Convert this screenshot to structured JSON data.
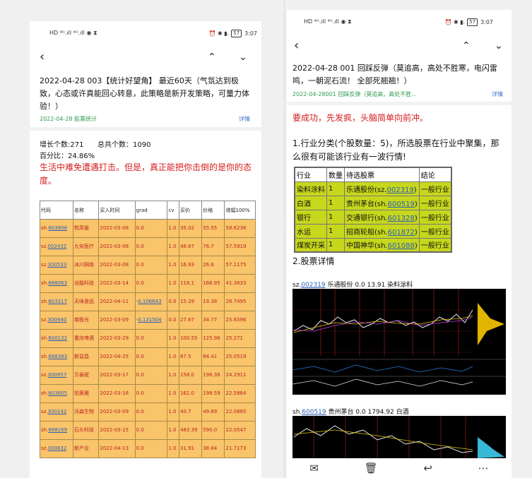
{
  "left": {
    "status": {
      "left_icons": "HD ⁴ᴳ.ıll ⁴ᴳ.ıll ◉ ⧗",
      "right_icons": "⏰ ✱ ▮ᵢ",
      "battery": "57",
      "time": "3:07"
    },
    "nav": {
      "back": "‹",
      "up": "⌃",
      "down": "⌄"
    },
    "title": "2022-04-28 003【统计好望角】 最近60天（气氛达到极致，心态或许真能回心转意，此策略是新开发策略，可量力体验！）",
    "meta": "2022-04-28 股票统计",
    "detail": "详情",
    "stats": {
      "growth": "增长个数:271",
      "total": "总共个数：1090",
      "percent": "百分比：24.86%"
    },
    "quote": "生活中难免遭遇打击。但是，真正能把你击倒的是你的态度。",
    "table": {
      "headers": [
        "代码",
        "名称",
        "买入时间",
        "grad",
        "cv",
        "买价",
        "价格",
        "增幅100%"
      ],
      "rows": [
        {
          "prefix": "sh.",
          "code": "603908",
          "name": "牧高笛",
          "date": "2022-03-08",
          "grad": "0.0",
          "cv": "1.0",
          "buy": "35.02",
          "price": "55.55",
          "inc": "58.6236"
        },
        {
          "prefix": "sz.",
          "code": "002432",
          "name": "九安医疗",
          "date": "2022-03-08",
          "grad": "0.0",
          "cv": "1.0",
          "buy": "48.67",
          "price": "76.7",
          "inc": "57.5919"
        },
        {
          "prefix": "sz.",
          "code": "300533",
          "name": "冰川网络",
          "date": "2022-03-08",
          "grad": "0.0",
          "cv": "1.0",
          "buy": "16.93",
          "price": "26.6",
          "inc": "57.1175"
        },
        {
          "prefix": "sh.",
          "code": "688063",
          "name": "派能科技",
          "date": "2022-03-14",
          "grad": "0.0",
          "cv": "1.0",
          "buy": "118.1",
          "price": "166.95",
          "inc": "41.3633"
        },
        {
          "prefix": "sh.",
          "code": "603317",
          "name": "天味食品",
          "date": "2022-04-11",
          "grad": "-0.106643",
          "cv": "0.0",
          "buy": "15.29",
          "price": "19.38",
          "inc": "26.7495"
        },
        {
          "prefix": "sz.",
          "code": "300940",
          "name": "南极光",
          "date": "2022-03-09",
          "grad": "-0.131504",
          "cv": "0.0",
          "buy": "27.67",
          "price": "34.77",
          "inc": "25.6596"
        },
        {
          "prefix": "sh.",
          "code": "600132",
          "name": "重庆啤酒",
          "date": "2022-03-29",
          "grad": "0.0",
          "cv": "1.0",
          "buy": "100.55",
          "price": "125.96",
          "inc": "25.271"
        },
        {
          "prefix": "sh.",
          "code": "688383",
          "name": "新益昌",
          "date": "2022-04-25",
          "grad": "0.0",
          "cv": "1.0",
          "buy": "67.5",
          "price": "84.41",
          "inc": "25.0519"
        },
        {
          "prefix": "sz.",
          "code": "300957",
          "name": "贝泰妮",
          "date": "2022-03-17",
          "grad": "0.0",
          "cv": "1.0",
          "buy": "158.0",
          "price": "196.38",
          "inc": "24.2911"
        },
        {
          "prefix": "sh.",
          "code": "603605",
          "name": "珀莱雅",
          "date": "2022-03-16",
          "grad": "0.0",
          "cv": "1.0",
          "buy": "162.0",
          "price": "198.59",
          "inc": "22.5864"
        },
        {
          "prefix": "sz.",
          "code": "300142",
          "name": "沃森生物",
          "date": "2022-03-09",
          "grad": "0.0",
          "cv": "1.0",
          "buy": "40.7",
          "price": "49.69",
          "inc": "22.0885"
        },
        {
          "prefix": "sh.",
          "code": "688169",
          "name": "石头科技",
          "date": "2022-03-15",
          "grad": "0.0",
          "cv": "1.0",
          "buy": "483.39",
          "price": "590.0",
          "inc": "22.0547"
        },
        {
          "prefix": "sz.",
          "code": "300832",
          "name": "新产业",
          "date": "2022-04-13",
          "grad": "0.0",
          "cv": "1.0",
          "buy": "31.91",
          "price": "38.84",
          "inc": "21.7173"
        }
      ]
    }
  },
  "right": {
    "status": {
      "left_icons": "HD ⁴ᴳ.ıll ⁴ᴳ.ıll ◉ ⧗",
      "right_icons": "⏰ ✱ ▮ᵢ",
      "battery": "57",
      "time": "3:07"
    },
    "nav": {
      "back": "‹",
      "up": "⌃",
      "down": "⌄"
    },
    "title": "2022-04-28 001 回踩反弹（莫追高，高处不胜寒，电闪雷鸣，一朝泥石流！ 全部死翘翘！）",
    "meta": "2022-04-28001 回踩反弹（莫追高，高处不胜...",
    "detail": "详情",
    "slogan": "要成功，先发疯，头脑简单向前冲。",
    "section1": "1.行业分类(个股数量：5)，所选股票在行业中聚集，那么很有可能该行业有一波行情!",
    "table": {
      "headers": [
        "行业",
        "数量",
        "待选股票",
        "结论"
      ],
      "rows": [
        {
          "industry": "染料涂料",
          "count": "1",
          "name": "乐通股份(sz.",
          "code": "002319",
          "close": ")",
          "result": "一般行业"
        },
        {
          "industry": "白酒",
          "count": "1",
          "name": "贵州茅台(sh.",
          "code": "600519",
          "close": ")",
          "result": "一般行业"
        },
        {
          "industry": "银行",
          "count": "1",
          "name": "交通银行(sh.",
          "code": "601328",
          "close": ")",
          "result": "一般行业"
        },
        {
          "industry": "水运",
          "count": "1",
          "name": "招商轮船(sh.",
          "code": "601872",
          "close": ")",
          "result": "一般行业"
        },
        {
          "industry": "煤炭开采",
          "count": "1",
          "name": "中国神华(sh.",
          "code": "601088",
          "close": ")",
          "result": "一般行业"
        }
      ]
    },
    "section2": "2.股票详情",
    "stock1": {
      "prefix": "sz.",
      "code": "002319",
      "rest": " 乐通股份  0.0  13.91   染料涂料"
    },
    "stock2": {
      "prefix": "sh.",
      "code": "600519",
      "rest": " 贵州茅台  0.0  1794.92   白酒"
    },
    "toolbar": {
      "mail": "✉",
      "delete": "🗑",
      "reply": "↩",
      "more": "⋯"
    }
  }
}
